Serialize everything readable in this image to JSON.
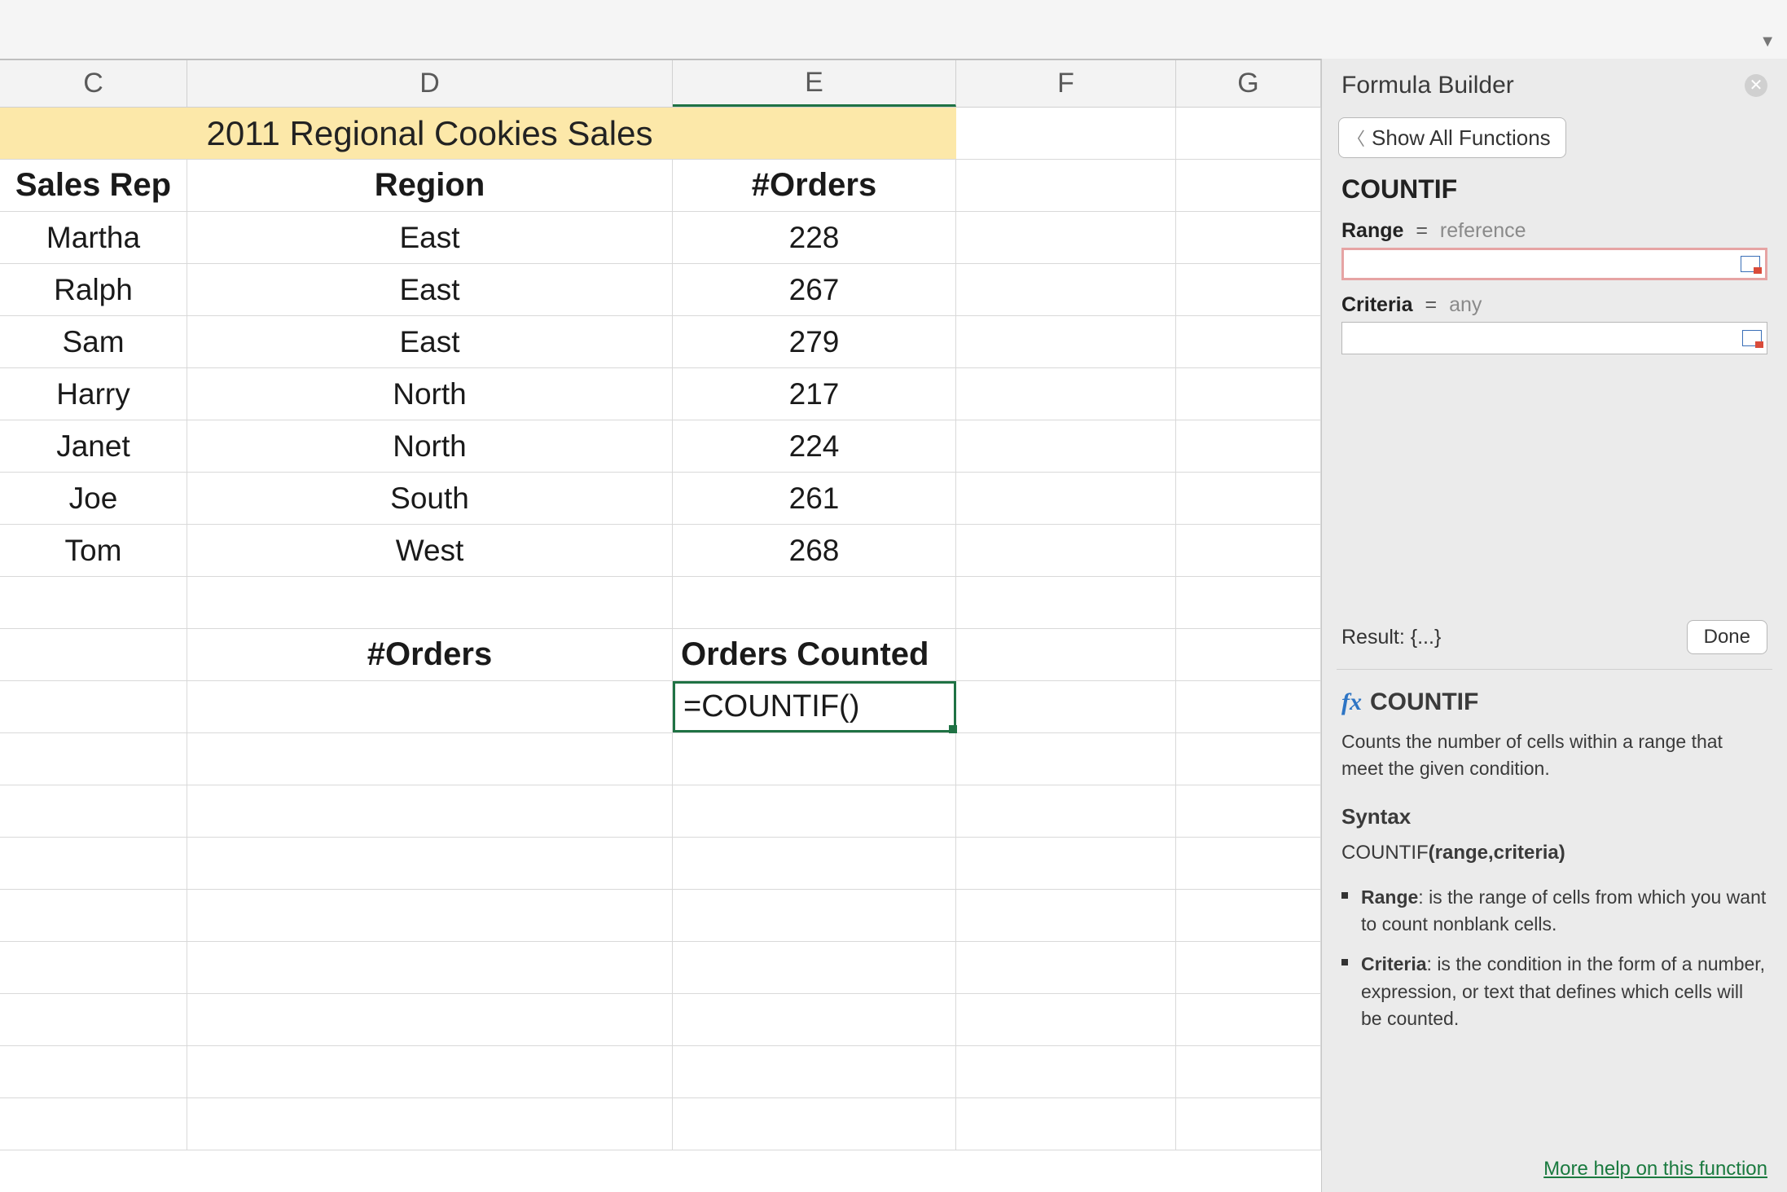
{
  "columns": [
    "C",
    "D",
    "E",
    "F",
    "G"
  ],
  "title_cell": "2011 Regional Cookies Sales",
  "headers": {
    "c": "Sales Rep",
    "d": "Region",
    "e": "#Orders"
  },
  "rows": [
    {
      "rep": "Martha",
      "region": "East",
      "orders": "228"
    },
    {
      "rep": "Ralph",
      "region": "East",
      "orders": "267"
    },
    {
      "rep": "Sam",
      "region": "East",
      "orders": "279"
    },
    {
      "rep": "Harry",
      "region": "North",
      "orders": "217"
    },
    {
      "rep": "Janet",
      "region": "North",
      "orders": "224"
    },
    {
      "rep": "Joe",
      "region": "South",
      "orders": "261"
    },
    {
      "rep": "Tom",
      "region": "West",
      "orders": "268"
    }
  ],
  "summary": {
    "d_label": "#Orders",
    "e_label": "Orders Counted",
    "formula": "=COUNTIF()"
  },
  "sidebar": {
    "title": "Formula Builder",
    "show_all": "Show All Functions",
    "fn": "COUNTIF",
    "args": {
      "range": {
        "label": "Range",
        "hint": "reference",
        "value": ""
      },
      "criteria": {
        "label": "Criteria",
        "hint": "any",
        "value": ""
      }
    },
    "result_label": "Result: {...}",
    "done": "Done",
    "help": {
      "fn": "COUNTIF",
      "desc": "Counts the number of cells within a range that meet the given condition.",
      "syntax_h": "Syntax",
      "syntax": "COUNTIF(range,criteria)",
      "syntax_bold": "(range,criteria)",
      "bullets": [
        {
          "b": "Range",
          "t": ": is the range of cells from which you want to count nonblank cells."
        },
        {
          "b": "Criteria",
          "t": ": is the condition in the form of a number, expression, or text that defines which cells will be counted."
        }
      ],
      "more": "More help on this function"
    }
  }
}
